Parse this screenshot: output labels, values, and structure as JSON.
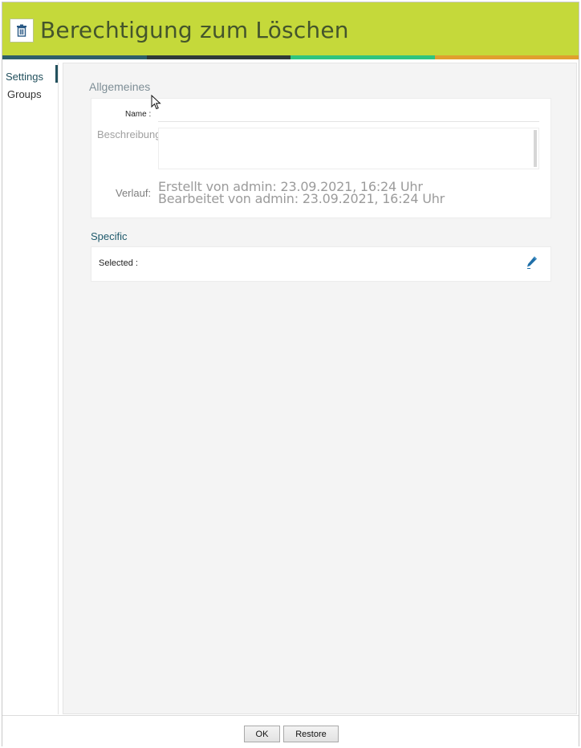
{
  "header": {
    "title": "Berechtigung zum Löschen",
    "icon": "trash-icon"
  },
  "stripes": [
    "#2d5f6a",
    "#2f3a38",
    "#2fc47e",
    "#e0a02e"
  ],
  "sidebar": {
    "items": [
      {
        "label": "Settings",
        "active": true
      },
      {
        "label": "Groups",
        "active": false
      }
    ]
  },
  "general": {
    "title": "Allgemeines",
    "name_label": "Name :",
    "name_value": "",
    "description_label": "Beschreibung:",
    "description_value": "",
    "history_label": "Verlauf:",
    "history_created": "Erstellt von admin: 23.09.2021, 16:24 Uhr",
    "history_edited": "Bearbeitet von admin: 23.09.2021, 16:24 Uhr"
  },
  "specific": {
    "title": "Specific",
    "selected_label": "Selected :",
    "edit_icon": "pencil-icon"
  },
  "footer": {
    "ok_label": "OK",
    "restore_label": "Restore"
  },
  "colors": {
    "header_bg": "#c5d93a",
    "accent": "#23515e",
    "edit_icon": "#1f6fa8"
  }
}
